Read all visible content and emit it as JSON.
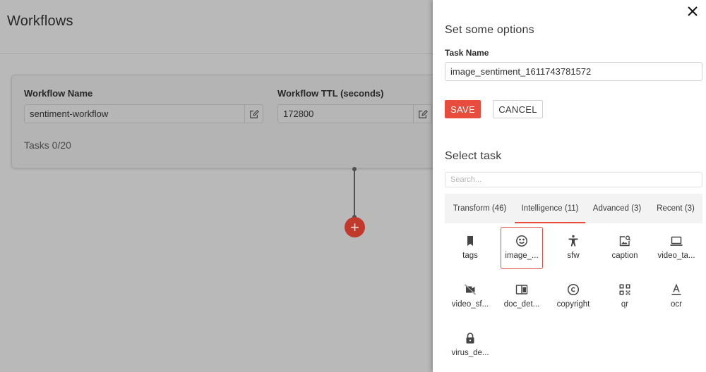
{
  "page": {
    "title": "Workflows",
    "workflow_name_label": "Workflow Name",
    "workflow_name_value": "sentiment-workflow",
    "workflow_ttl_label": "Workflow TTL (seconds)",
    "workflow_ttl_value": "172800",
    "tasks_count": "Tasks 0/20",
    "add_node_symbol": "+"
  },
  "drawer": {
    "options_title": "Set some options",
    "task_name_label": "Task Name",
    "task_name_value": "image_sentiment_1611743781572",
    "save_label": "SAVE",
    "cancel_label": "CANCEL",
    "select_title": "Select task",
    "search_placeholder": "Search...",
    "tabs": [
      {
        "label": "Transform (46)"
      },
      {
        "label": "Intelligence (11)"
      },
      {
        "label": "Advanced (3)"
      },
      {
        "label": "Recent (3)"
      }
    ],
    "active_tab": 1,
    "tasks": [
      {
        "label": "tags",
        "icon": "bookmark-icon"
      },
      {
        "label": "image_...",
        "icon": "smiley-icon"
      },
      {
        "label": "sfw",
        "icon": "accessibility-icon"
      },
      {
        "label": "caption",
        "icon": "image-search-icon"
      },
      {
        "label": "video_ta...",
        "icon": "laptop-icon"
      },
      {
        "label": "video_sf...",
        "icon": "videocam-off-icon"
      },
      {
        "label": "doc_det...",
        "icon": "chrome-reader-icon"
      },
      {
        "label": "copyright",
        "icon": "copyright-icon"
      },
      {
        "label": "qr",
        "icon": "qr-code-icon"
      },
      {
        "label": "ocr",
        "icon": "text-format-icon"
      },
      {
        "label": "virus_de...",
        "icon": "lock-icon"
      }
    ],
    "selected_task": 1
  },
  "colors": {
    "accent": "#e74c3c",
    "add_node": "#c0392b",
    "overlay_bg": "#b9b9b9"
  }
}
